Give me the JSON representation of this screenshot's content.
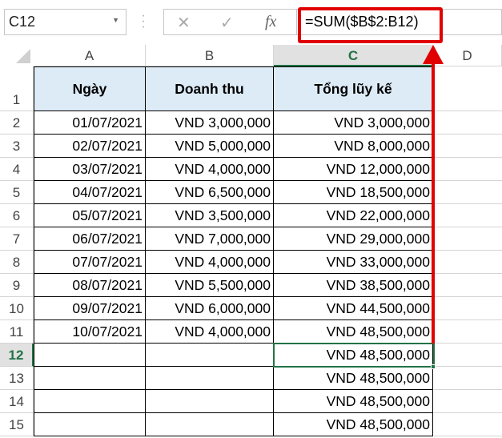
{
  "name_box": {
    "value": "C12"
  },
  "formula_bar": {
    "cancel_icon": "✕",
    "enter_icon": "✓",
    "fx_label": "fx",
    "formula": "=SUM($B$2:B12)"
  },
  "columns": [
    "A",
    "B",
    "C",
    "D"
  ],
  "selected_column": "C",
  "selected_row": "12",
  "headers": [
    "Ngày",
    "Doanh thu",
    "Tổng lũy kế"
  ],
  "rows": [
    {
      "n": "1"
    },
    {
      "n": "2",
      "a": "01/07/2021",
      "b": "VND 3,000,000",
      "c": "VND 3,000,000"
    },
    {
      "n": "3",
      "a": "02/07/2021",
      "b": "VND 5,000,000",
      "c": "VND 8,000,000"
    },
    {
      "n": "4",
      "a": "03/07/2021",
      "b": "VND 4,000,000",
      "c": "VND 12,000,000"
    },
    {
      "n": "5",
      "a": "04/07/2021",
      "b": "VND 6,500,000",
      "c": "VND 18,500,000"
    },
    {
      "n": "6",
      "a": "05/07/2021",
      "b": "VND 3,500,000",
      "c": "VND 22,000,000"
    },
    {
      "n": "7",
      "a": "06/07/2021",
      "b": "VND 7,000,000",
      "c": "VND 29,000,000"
    },
    {
      "n": "8",
      "a": "07/07/2021",
      "b": "VND 4,000,000",
      "c": "VND 33,000,000"
    },
    {
      "n": "9",
      "a": "08/07/2021",
      "b": "VND 5,500,000",
      "c": "VND 38,500,000"
    },
    {
      "n": "10",
      "a": "09/07/2021",
      "b": "VND 6,000,000",
      "c": "VND 44,500,000"
    },
    {
      "n": "11",
      "a": "10/07/2021",
      "b": "VND 4,000,000",
      "c": "VND 48,500,000"
    },
    {
      "n": "12",
      "a": "",
      "b": "",
      "c": "VND 48,500,000"
    },
    {
      "n": "13",
      "a": "",
      "b": "",
      "c": "VND 48,500,000"
    },
    {
      "n": "14",
      "a": "",
      "b": "",
      "c": "VND 48,500,000"
    },
    {
      "n": "15",
      "a": "",
      "b": "",
      "c": "VND 48,500,000"
    }
  ],
  "colors": {
    "highlight": "#e00000",
    "header_fill": "#ddebf7",
    "selection": "#217346"
  }
}
